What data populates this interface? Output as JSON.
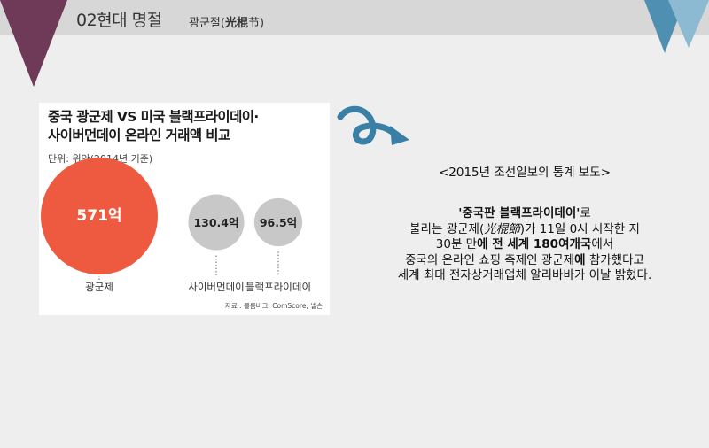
{
  "header": {
    "section_title": "02현대 명절",
    "subtitle_korean": "광군절",
    "subtitle_paren_open": "(",
    "subtitle_hanja": "光棍",
    "subtitle_hanja_tail": "节",
    "subtitle_paren_close": ")"
  },
  "colors": {
    "header_bar": "#d7d7d7",
    "left_triangle": "#6e3a57",
    "accent_blue_dark": "#4e8fb2",
    "accent_blue_light": "#8bbad2",
    "bubble_large": "#ee5a40",
    "bubble_small": "#c8c8c8",
    "swoosh": "#3a7fa6"
  },
  "icons": {
    "swoosh": "curved-arrow-icon"
  },
  "chart_data": {
    "type": "bubble",
    "title_line1": "중국 광군제 VS 미국 블랙프라이데이·",
    "title_line2": "사이버먼데이 온라인 거래액 비교",
    "unit": "단위: 위안(2014년 기준)",
    "categories": [
      "광군제",
      "사이버먼데이",
      "블랙프라이데이"
    ],
    "values": [
      571,
      130.4,
      96.5
    ],
    "value_labels": [
      "571억",
      "130.4억",
      "96.5억"
    ],
    "source": "자료 : 블룸버그, ComScore, 넬슨"
  },
  "report": {
    "heading": "<2015년 조선일보의 통계 보도>",
    "line1_bold": "'중국판 블랙프라이데이'",
    "line1_rest": "로",
    "line2_pre": "불리는 광군제(",
    "line2_hanja": "光棍節",
    "line2_post": ")가 11일 0시 시작한 지",
    "line3_pre": "30분 만",
    "line3_bold1": "에 전 세계 180여개국",
    "line3_post": "에서",
    "line4_pre": "중국의 온라인 쇼핑 축제인 광군제",
    "line4_bold": "에",
    "line4_post": " 참가했다고",
    "line5": "세계 최대 전자상거래업체 알리바바가 이날 밝혔다."
  }
}
